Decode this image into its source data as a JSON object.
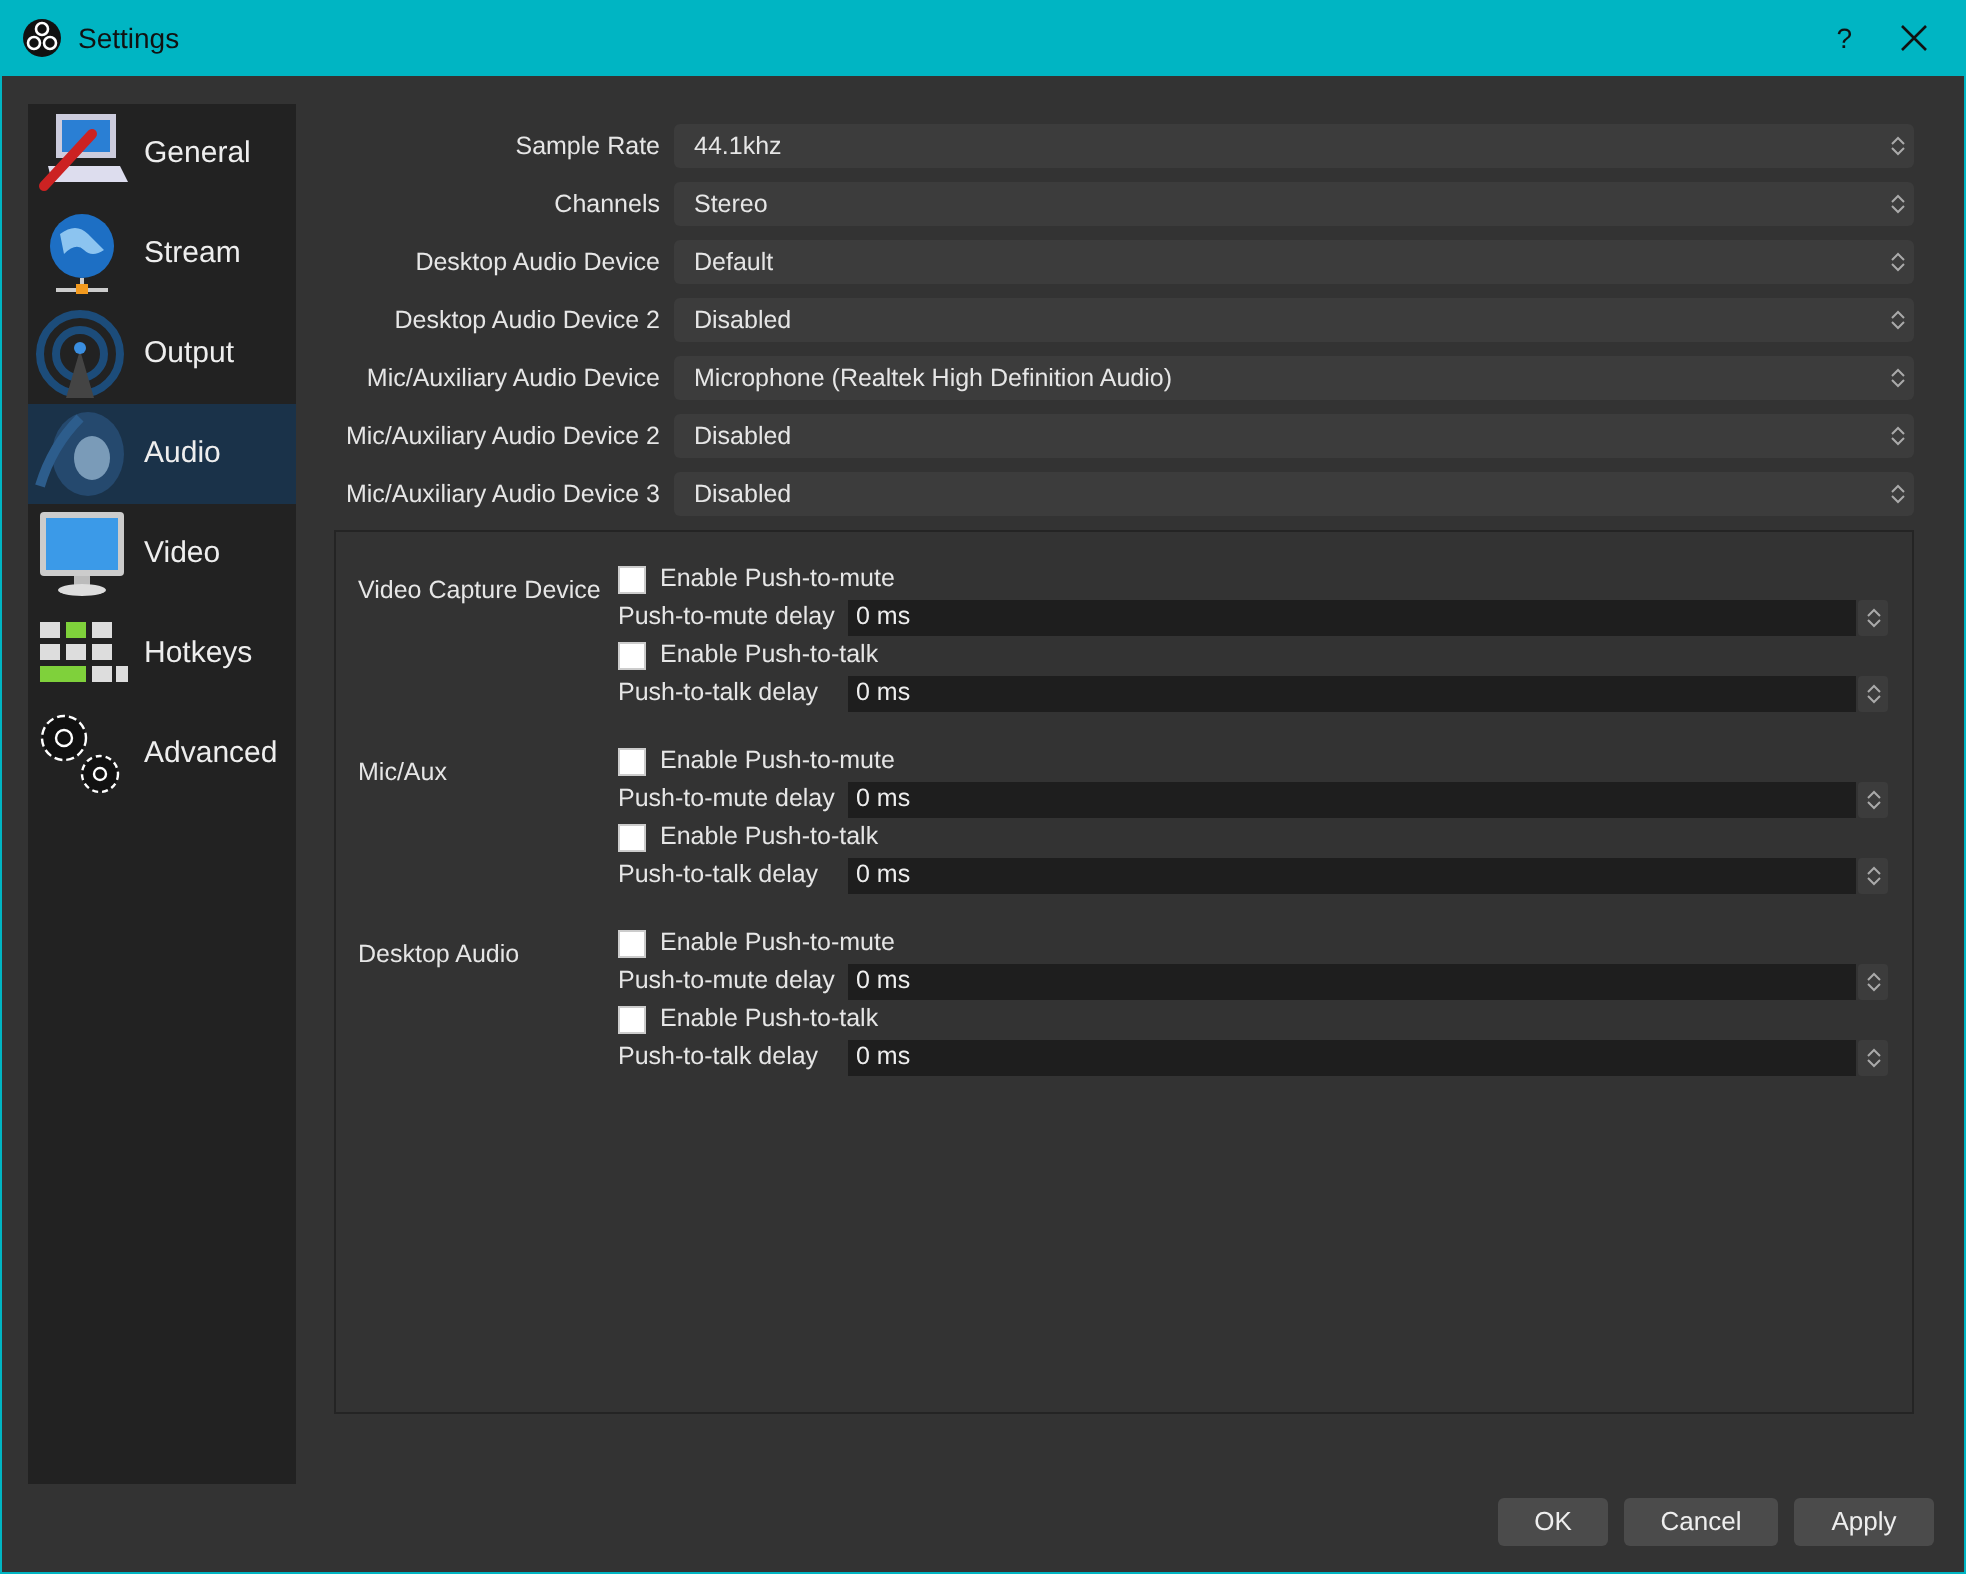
{
  "window": {
    "title": "Settings",
    "help": "?"
  },
  "sidebar": {
    "items": [
      {
        "label": "General",
        "kind": "general",
        "selected": false
      },
      {
        "label": "Stream",
        "kind": "stream",
        "selected": false
      },
      {
        "label": "Output",
        "kind": "output",
        "selected": false
      },
      {
        "label": "Audio",
        "kind": "audio",
        "selected": true
      },
      {
        "label": "Video",
        "kind": "video",
        "selected": false
      },
      {
        "label": "Hotkeys",
        "kind": "hotkeys",
        "selected": false
      },
      {
        "label": "Advanced",
        "kind": "advanced",
        "selected": false
      }
    ]
  },
  "audio_settings": [
    {
      "label": "Sample Rate",
      "value": "44.1khz"
    },
    {
      "label": "Channels",
      "value": "Stereo"
    },
    {
      "label": "Desktop Audio Device",
      "value": "Default"
    },
    {
      "label": "Desktop Audio Device 2",
      "value": "Disabled"
    },
    {
      "label": "Mic/Auxiliary Audio Device",
      "value": "Microphone (Realtek High Definition Audio)"
    },
    {
      "label": "Mic/Auxiliary Audio Device 2",
      "value": "Disabled"
    },
    {
      "label": "Mic/Auxiliary Audio Device 3",
      "value": "Disabled"
    }
  ],
  "hotkeys": [
    {
      "source": "Video Capture Device",
      "controls": [
        {
          "kind": "checkbox",
          "label": "Enable Push-to-mute",
          "checked": false
        },
        {
          "kind": "delay",
          "label": "Push-to-mute delay",
          "value": "0 ms"
        },
        {
          "kind": "checkbox",
          "label": "Enable Push-to-talk",
          "checked": false
        },
        {
          "kind": "delay",
          "label": "Push-to-talk delay",
          "value": "0 ms"
        }
      ]
    },
    {
      "source": "Mic/Aux",
      "controls": [
        {
          "kind": "checkbox",
          "label": "Enable Push-to-mute",
          "checked": false
        },
        {
          "kind": "delay",
          "label": "Push-to-mute delay",
          "value": "0 ms"
        },
        {
          "kind": "checkbox",
          "label": "Enable Push-to-talk",
          "checked": false
        },
        {
          "kind": "delay",
          "label": "Push-to-talk delay",
          "value": "0 ms"
        }
      ]
    },
    {
      "source": "Desktop Audio",
      "controls": [
        {
          "kind": "checkbox",
          "label": "Enable Push-to-mute",
          "checked": false
        },
        {
          "kind": "delay",
          "label": "Push-to-mute delay",
          "value": "0 ms"
        },
        {
          "kind": "checkbox",
          "label": "Enable Push-to-talk",
          "checked": false
        },
        {
          "kind": "delay",
          "label": "Push-to-talk delay",
          "value": "0 ms"
        }
      ]
    }
  ],
  "buttons": [
    "OK",
    "Cancel",
    "Apply"
  ]
}
